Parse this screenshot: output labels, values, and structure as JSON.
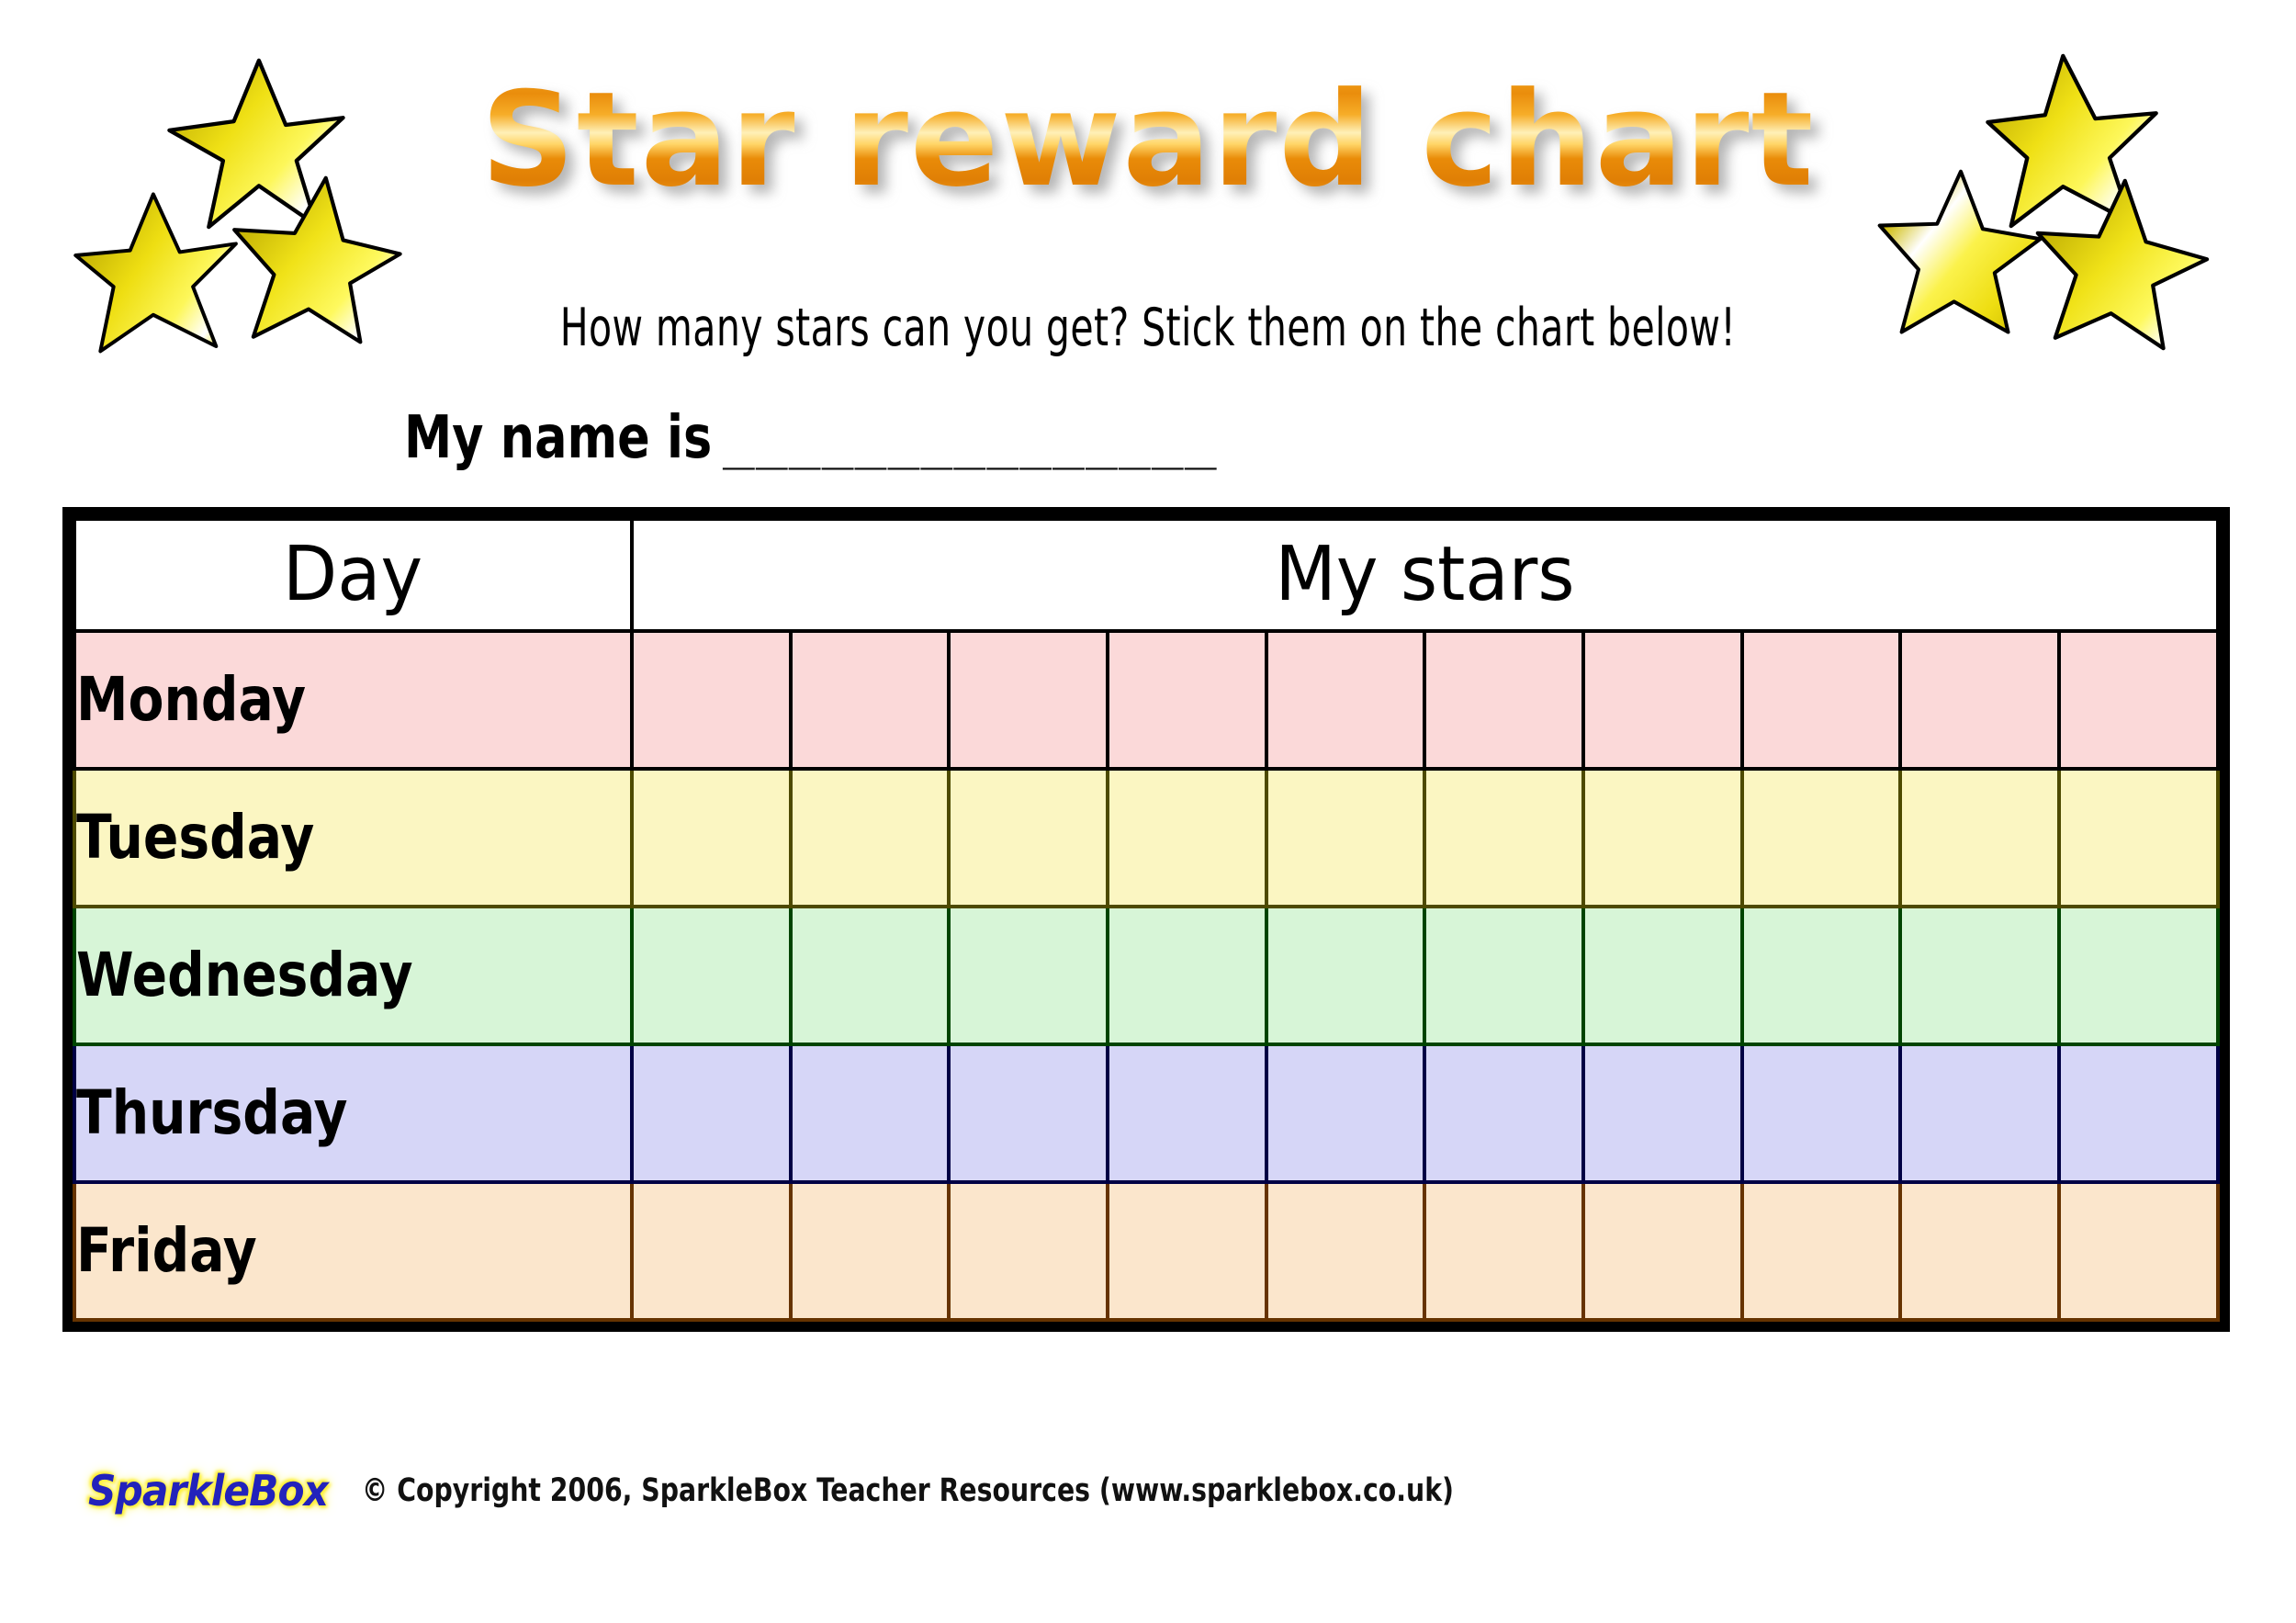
{
  "page": {
    "title": "Star reward chart",
    "subtitle": "How many stars can you get?  Stick them on the chart below!",
    "name_label": "My name is",
    "name_blank": "_______________"
  },
  "colors": {
    "title_orange": "#ea8d0c",
    "star_yellow": "#f2e415",
    "star_gold": "#c9b400",
    "logo_blue": "#2222bb",
    "logo_glow": "#fff34d"
  },
  "decorations": {
    "star_clusters": [
      {
        "name": "stars-top-left",
        "count": 3
      },
      {
        "name": "stars-top-right",
        "count": 3
      }
    ]
  },
  "chart": {
    "headers": {
      "day": "Day",
      "stars": "My stars"
    },
    "star_column_count": 10,
    "rows": [
      {
        "day": "Monday",
        "fill": "#fbd9d9",
        "border": "#000000",
        "stars": 0
      },
      {
        "day": "Tuesday",
        "fill": "#fbf6c2",
        "border": "#4d4a00",
        "stars": 0
      },
      {
        "day": "Wednesday",
        "fill": "#d7f5d7",
        "border": "#004400",
        "stars": 0
      },
      {
        "day": "Thursday",
        "fill": "#d6d6f7",
        "border": "#000044",
        "stars": 0
      },
      {
        "day": "Friday",
        "fill": "#fbe6cc",
        "border": "#663300",
        "stars": 0
      }
    ]
  },
  "chart_data": {
    "type": "table",
    "title": "Star reward chart",
    "categories": [
      "Monday",
      "Tuesday",
      "Wednesday",
      "Thursday",
      "Friday"
    ],
    "values": [
      0,
      0,
      0,
      0,
      0
    ],
    "xlabel": "Day",
    "ylabel": "My stars",
    "ylim": [
      0,
      10
    ],
    "grid": true,
    "legend": "none",
    "note": "Blank reward chart: 5 day rows x 10 empty sticker cells each."
  },
  "footer": {
    "logo": "SparkleBox",
    "copyright": "© Copyright 2006, SparkleBox Teacher Resources (www.sparklebox.co.uk)"
  }
}
